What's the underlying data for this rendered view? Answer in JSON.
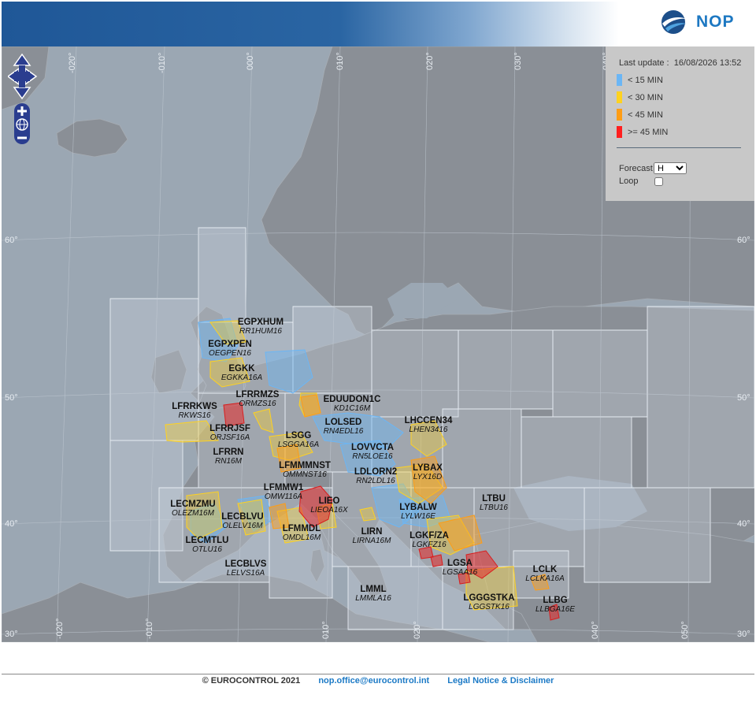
{
  "header": {
    "logo_text": "NOP"
  },
  "panel": {
    "last_update_label": "Last update :",
    "last_update_value": "16/08/2026 13:52",
    "legend": [
      {
        "label": "< 15 MIN",
        "color": "#6bb6f5"
      },
      {
        "label": "< 30 MIN",
        "color": "#ffd21f"
      },
      {
        "label": "< 45 MIN",
        "color": "#ff9d14"
      },
      {
        "label": ">= 45 MIN",
        "color": "#ff1f1f"
      }
    ],
    "forecast_label": "Forecast",
    "forecast_value": "H",
    "loop_label": "Loop"
  },
  "lat_labels": [
    "60°",
    "50°",
    "40°",
    "30°"
  ],
  "lon_labels": [
    "-020°",
    "-010°",
    "000°",
    "010°",
    "020°",
    "030°",
    "040°",
    "050°"
  ],
  "sectors": [
    {
      "name": "EGPXHUM",
      "code": "RR1HUM16"
    },
    {
      "name": "EGPXPEN",
      "code": "OEGPEN16"
    },
    {
      "name": "EGKK",
      "code": "EGKKA16A"
    },
    {
      "name": "LFRRMZS",
      "code": "ORMZS16"
    },
    {
      "name": "LFRRKWS",
      "code": "RKWS16"
    },
    {
      "name": "LFRRJSF",
      "code": "ORJSF16A"
    },
    {
      "name": "LFRRN",
      "code": "RN16M"
    },
    {
      "name": "EDUUDON1C",
      "code": "KD1C16M"
    },
    {
      "name": "LOLSED",
      "code": "RN4EDL16"
    },
    {
      "name": "LSGG",
      "code": "LSGGA16A"
    },
    {
      "name": "LHCCEN34",
      "code": "LHEN3416"
    },
    {
      "name": "LOVVCTA",
      "code": "RN5LOE16"
    },
    {
      "name": "LFMMMNST",
      "code": "OMMNST16"
    },
    {
      "name": "LDLORN2",
      "code": "RN2LDL16"
    },
    {
      "name": "LYBAX",
      "code": "LYX16D"
    },
    {
      "name": "LFMMW1",
      "code": "OMW116A"
    },
    {
      "name": "LIEO",
      "code": "LIEOA16X"
    },
    {
      "name": "LECMZMU",
      "code": "OLEZM16M"
    },
    {
      "name": "LECBLVU",
      "code": "OLELV16M"
    },
    {
      "name": "LYBALW",
      "code": "LYLW16E"
    },
    {
      "name": "LTBU",
      "code": "LTBU16"
    },
    {
      "name": "LFMMDL",
      "code": "OMDL16M"
    },
    {
      "name": "LIRN",
      "code": "LIRNA16M"
    },
    {
      "name": "LECMTLU",
      "code": "OTLU16"
    },
    {
      "name": "LGKF/ZA",
      "code": "LGKFZ16"
    },
    {
      "name": "LGSA",
      "code": "LGSAA16"
    },
    {
      "name": "LECBLVS",
      "code": "LELVS16A"
    },
    {
      "name": "LCLK",
      "code": "LCLKA16A"
    },
    {
      "name": "LMML",
      "code": "LMMLA16"
    },
    {
      "name": "LGGGSTKA",
      "code": "LGGSTK16"
    },
    {
      "name": "LLBG",
      "code": "LLBGA16E"
    }
  ],
  "footer": {
    "copyright": "© EUROCONTROL 2021",
    "email": "nop.office@eurocontrol.int",
    "legal": "Legal Notice & Disclaimer"
  }
}
